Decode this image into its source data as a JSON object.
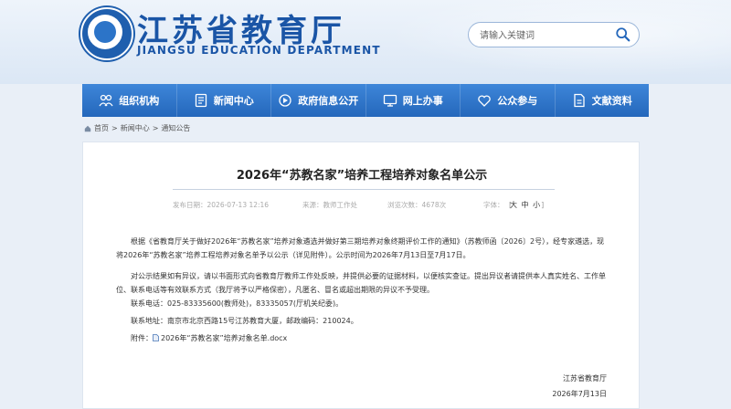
{
  "header": {
    "site_title": "江苏省教育厅",
    "site_subtitle": "JIANGSU EDUCATION DEPARTMENT",
    "search_placeholder": "请输入关键词"
  },
  "nav": [
    {
      "label": "组织机构",
      "icon": "organization-icon"
    },
    {
      "label": "新闻中心",
      "icon": "news-icon"
    },
    {
      "label": "政府信息公开",
      "icon": "disclosure-icon"
    },
    {
      "label": "网上办事",
      "icon": "online-service-icon"
    },
    {
      "label": "公众参与",
      "icon": "heart-icon"
    },
    {
      "label": "文献资料",
      "icon": "document-icon"
    }
  ],
  "breadcrumb": {
    "home": "首页",
    "sep": ">",
    "news": "新闻中心",
    "notices": "通知公告"
  },
  "article": {
    "title": "2026年“苏教名家”培养工程培养对象名单公示",
    "meta": {
      "publish_label": "发布日期：2026-07-13 12:16",
      "source_label": "来源：教师工作处",
      "views_label": "浏览次数：4678次",
      "fontsize_label": "字体：",
      "bracket_open": "[",
      "size_large": "大",
      "size_medium": "中",
      "size_small": "小",
      "bracket_close": "]"
    },
    "paragraphs": [
      "根据《省教育厅关于做好2026年“苏教名家”培养对象遴选并做好第三期培养对象终期评价工作的通知》（苏教师函〔2026〕2号），经专家遴选，现将2026年“苏教名家”培养工程培养对象名单予以公示（详见附件）。公示时间为2026年7月13日至7月17日。",
      "对公示结果如有异议，请以书面形式向省教育厅教师工作处反映，并提供必要的证据材料，以便核实查证。提出异议者请提供本人真实姓名、工作单位、联系电话等有效联系方式（我厅将予以严格保密），凡匿名、冒名或超出期限的异议不予受理。"
    ],
    "contact_phone": "联系电话：025-83335600(教师处)，83335057(厅机关纪委)。",
    "contact_address": "联系地址：南京市北京西路15号江苏教育大厦，邮政编码：210024。",
    "attachment_label": "附件：",
    "attachment_name": "2026年“苏教名家”培养对象名单.docx",
    "signature_org": "江苏省教育厅",
    "signature_date": "2026年7月13日"
  },
  "colors": {
    "nav_bg": "#2a6fc4",
    "brand_blue": "#1a55a6",
    "page_bg": "#e9eff7"
  }
}
